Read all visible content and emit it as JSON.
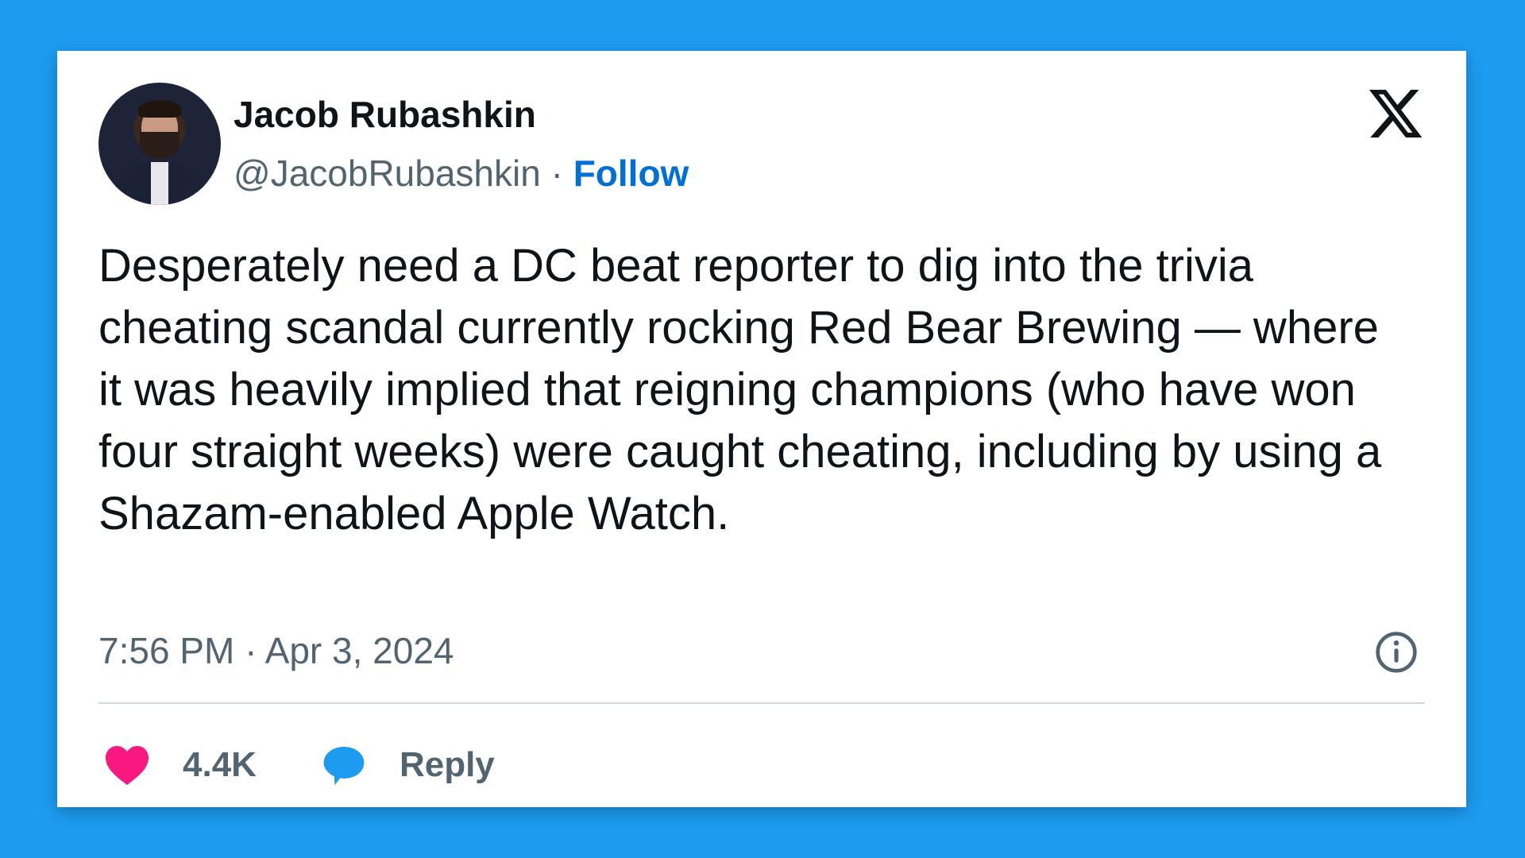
{
  "tweet": {
    "author": {
      "display_name": "Jacob Rubashkin",
      "handle": "@JacobRubashkin",
      "separator": "·",
      "follow_label": "Follow"
    },
    "text": "Desperately need a DC beat reporter to dig into the trivia cheating scandal currently rocking Red Bear Brewing — where it was heavily implied that reigning champions (who have won four straight weeks) were caught cheating, including by using a Shazam-enabled Apple Watch.",
    "timestamp": "7:56 PM · Apr 3, 2024",
    "likes_count": "4.4K",
    "reply_label": "Reply"
  },
  "icons": {
    "logo": "x-logo-icon",
    "info": "info-icon",
    "like": "heart-icon",
    "reply": "speech-bubble-icon"
  },
  "colors": {
    "background": "#1d9bf0",
    "card": "#ffffff",
    "follow": "#006fd6",
    "heart": "#f91880",
    "reply_bubble": "#1d9bf0",
    "secondary_text": "#536471",
    "primary_text": "#0f1419"
  }
}
